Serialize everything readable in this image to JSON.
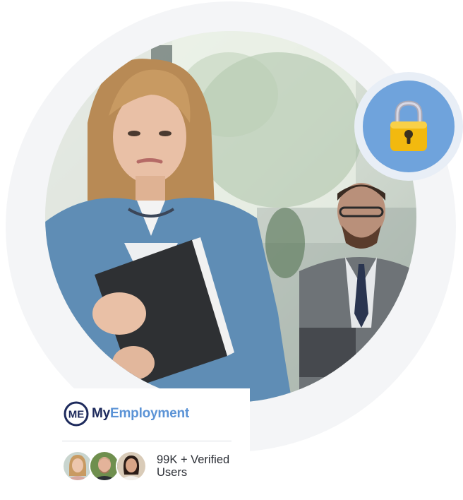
{
  "brand": {
    "logo_icon": "me-monogram-logo-icon",
    "name_primary": "My",
    "name_accent": "Employment",
    "colors": {
      "primary": "#1d2a5c",
      "accent": "#5b93d6"
    }
  },
  "users": {
    "count_label": "99K + Verified Users",
    "avatars": [
      "user-avatar-woman",
      "user-avatar-man",
      "user-avatar-woman-dark-hair"
    ]
  },
  "badge": {
    "icon": "padlock-icon",
    "color": "#6fa3dc"
  },
  "hero": {
    "icon": "worried-employee-photo"
  }
}
